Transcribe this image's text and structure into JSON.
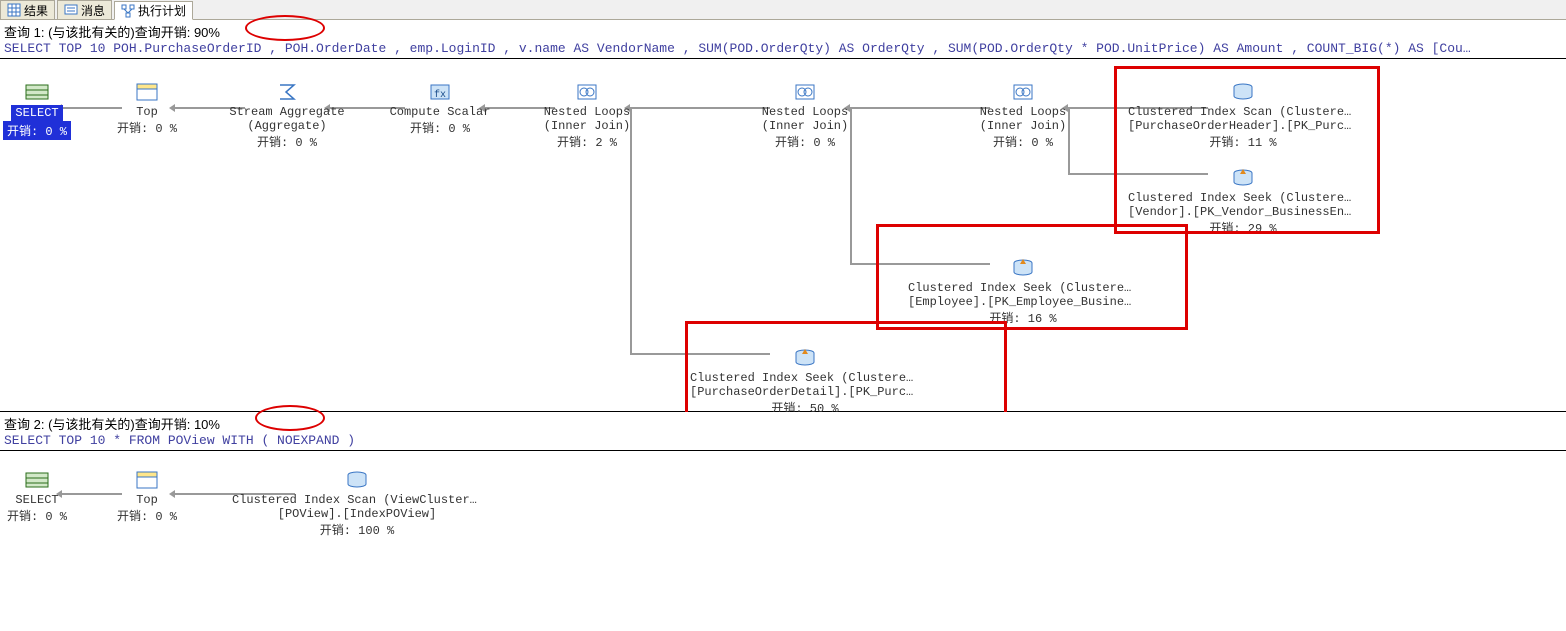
{
  "tabs": {
    "results": "结果",
    "messages": "消息",
    "plan": "执行计划"
  },
  "query1": {
    "header": "查询 1: (与该批有关的)查询开销: 90%",
    "sql": "SELECT TOP 10 POH.PurchaseOrderID , POH.OrderDate , emp.LoginID , v.name AS VendorName , SUM(POD.OrderQty) AS OrderQty , SUM(POD.OrderQty * POD.UnitPrice) AS Amount , COUNT_BIG(*) AS [Cou…"
  },
  "query2": {
    "header": "查询 2: (与该批有关的)查询开销: 10%",
    "sql": "SELECT TOP 10 * FROM POView WITH ( NOEXPAND )"
  },
  "nodes1": {
    "select": {
      "l1": "SELECT",
      "cost": "开销: 0 %"
    },
    "top": {
      "l1": "Top",
      "cost": "开销: 0 %"
    },
    "streamAgg": {
      "l1": "Stream Aggregate",
      "l2": "(Aggregate)",
      "cost": "开销: 0 %"
    },
    "scalar": {
      "l1": "Compute Scalar",
      "cost": "开销: 0 %"
    },
    "nl1": {
      "l1": "Nested Loops",
      "l2": "(Inner Join)",
      "cost": "开销: 2 %"
    },
    "nl2": {
      "l1": "Nested Loops",
      "l2": "(Inner Join)",
      "cost": "开销: 0 %"
    },
    "nl3": {
      "l1": "Nested Loops",
      "l2": "(Inner Join)",
      "cost": "开销: 0 %"
    },
    "scanPOH": {
      "l1": "Clustered Index Scan (Clustered)",
      "l2": "[PurchaseOrderHeader].[PK_PurchaseO…",
      "cost": "开销: 11 %"
    },
    "seekVendor": {
      "l1": "Clustered Index Seek (Clustered)",
      "l2": "[Vendor].[PK_Vendor_BusinessEntityI…",
      "cost": "开销: 29 %"
    },
    "seekEmp": {
      "l1": "Clustered Index Seek (Clustered)",
      "l2": "[Employee].[PK_Employee_BusinessEnt…",
      "cost": "开销: 16 %"
    },
    "seekPOD": {
      "l1": "Clustered Index Seek (Clustered)",
      "l2": "[PurchaseOrderDetail].[PK_PurchaseO…",
      "cost": "开销: 50 %"
    }
  },
  "nodes2": {
    "select": {
      "l1": "SELECT",
      "cost": "开销: 0 %"
    },
    "top": {
      "l1": "Top",
      "cost": "开销: 0 %"
    },
    "scan": {
      "l1": "Clustered Index Scan (ViewClustered)",
      "l2": "[POView].[IndexPOView]",
      "cost": "开销: 100 %"
    }
  }
}
